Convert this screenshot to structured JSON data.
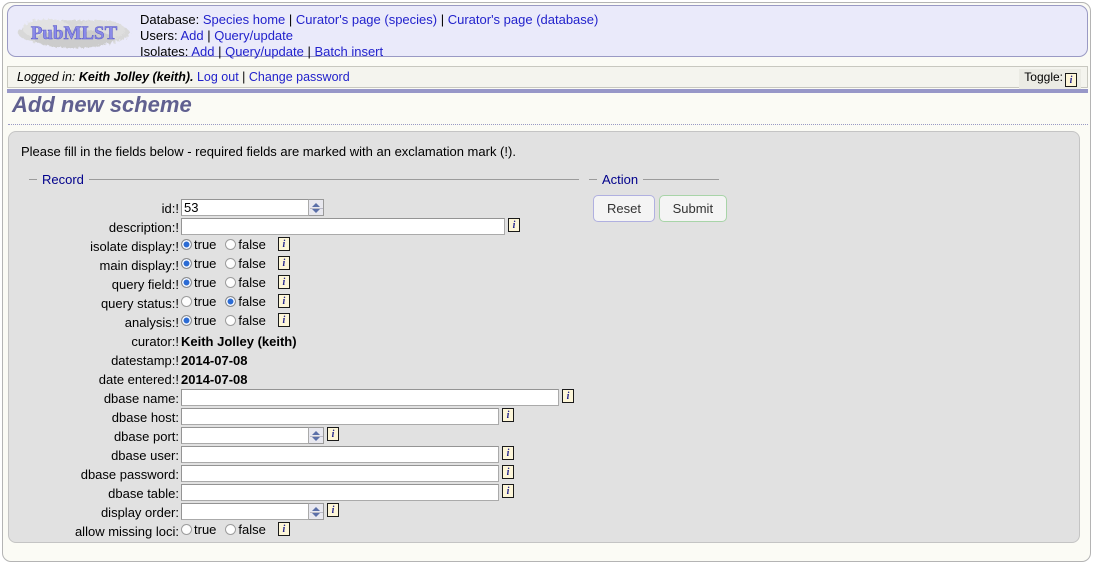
{
  "header": {
    "logo_text": "PubMLST",
    "nav": [
      {
        "label": "Database:",
        "links": [
          "Species home",
          "Curator's page (species)",
          "Curator's page (database)"
        ]
      },
      {
        "label": "Users:",
        "links": [
          "Add",
          "Query/update"
        ]
      },
      {
        "label": "Isolates:",
        "links": [
          "Add",
          "Query/update",
          "Batch insert"
        ]
      }
    ],
    "separator": " | "
  },
  "login_bar": {
    "prefix": "Logged in:",
    "user": "Keith Jolley (keith).",
    "logout_label": "Log out",
    "separator": " | ",
    "change_password_label": "Change password",
    "toggle_label": "Toggle:",
    "toggle_icon": "info-icon"
  },
  "page_title": "Add new scheme",
  "instructions": "Please fill in the fields below - required fields are marked with an exclamation mark (!).",
  "record": {
    "legend": "Record",
    "fields": [
      {
        "label": "id:!",
        "type": "number",
        "value": "53",
        "width": "w-id",
        "info": false
      },
      {
        "label": "description:!",
        "type": "text",
        "value": "",
        "width": "w-desc",
        "info": true
      },
      {
        "label": "isolate display:!",
        "type": "radio",
        "selected": "true",
        "info": true
      },
      {
        "label": "main display:!",
        "type": "radio",
        "selected": "true",
        "info": true
      },
      {
        "label": "query field:!",
        "type": "radio",
        "selected": "true",
        "info": true
      },
      {
        "label": "query status:!",
        "type": "radio",
        "selected": "false",
        "info": true
      },
      {
        "label": "analysis:!",
        "type": "radio",
        "selected": "true",
        "info": true
      },
      {
        "label": "curator:!",
        "type": "static",
        "value": "Keith Jolley (keith)"
      },
      {
        "label": "datestamp:!",
        "type": "static",
        "value": "2014-07-08"
      },
      {
        "label": "date entered:!",
        "type": "static",
        "value": "2014-07-08"
      },
      {
        "label": "dbase name:",
        "type": "text",
        "value": "",
        "width": "w-dbname",
        "info": true
      },
      {
        "label": "dbase host:",
        "type": "text",
        "value": "",
        "width": "w-std",
        "info": true
      },
      {
        "label": "dbase port:",
        "type": "number",
        "value": "",
        "width": "w-port",
        "info": true
      },
      {
        "label": "dbase user:",
        "type": "text",
        "value": "",
        "width": "w-std",
        "info": true
      },
      {
        "label": "dbase password:",
        "type": "text",
        "value": "",
        "width": "w-std",
        "info": true
      },
      {
        "label": "dbase table:",
        "type": "text",
        "value": "",
        "width": "w-std",
        "info": true
      },
      {
        "label": "display order:",
        "type": "number",
        "value": "",
        "width": "w-port",
        "info": true
      },
      {
        "label": "allow missing loci:",
        "type": "radio",
        "selected": "none",
        "info": true
      }
    ],
    "radio_true_label": "true",
    "radio_false_label": "false"
  },
  "action": {
    "legend": "Action",
    "reset_label": "Reset",
    "submit_label": "Submit"
  },
  "colors": {
    "link": "#2222cc",
    "legend": "#00008b",
    "title": "#606090",
    "banner_bg": "#eaeafa",
    "panel_bg": "#e1e1e1",
    "radio_on": "#2b6bd4",
    "rule": "#9797c8"
  }
}
